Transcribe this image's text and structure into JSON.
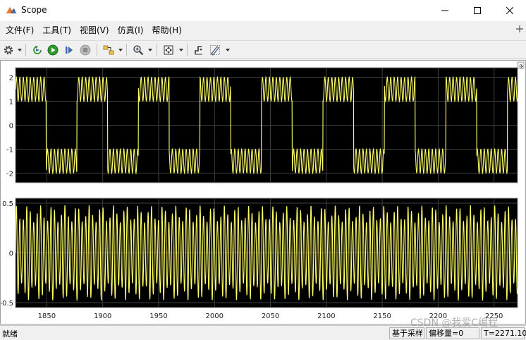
{
  "window": {
    "title": "Scope",
    "icon": "matlab-scope-icon",
    "controls": [
      "minimize-icon",
      "maximize-icon",
      "close-icon"
    ]
  },
  "menu": {
    "items": [
      {
        "label": "文件(F)"
      },
      {
        "label": "工具(T)"
      },
      {
        "label": "视图(V)"
      },
      {
        "label": "仿真(I)"
      },
      {
        "label": "帮助(H)"
      }
    ]
  },
  "toolbar": {
    "icons": [
      "gear-icon",
      "step-back-icon",
      "run-icon",
      "step-forward-icon",
      "stop-icon",
      "highlight-block-icon",
      "zoom-in-icon",
      "fit-to-view-icon",
      "triggers-icon",
      "cursor-measurement-icon"
    ]
  },
  "colors": {
    "plot_bg": "#000000",
    "axes_bg": "#ffffff",
    "grid": "#404040",
    "signal": "#ffff66",
    "axis_text": "#222222"
  },
  "chart_data": [
    {
      "type": "line",
      "yticks": [
        "2",
        "1",
        "0",
        "-1",
        "-2"
      ],
      "ylim": [
        -2.4,
        2.4
      ],
      "xlim": [
        1822,
        2271
      ],
      "grid": true,
      "series": [
        {
          "color": "#ffff66",
          "pattern": "square wave of amplitude 1.5 with superimposed high-frequency oscillation of amplitude 0.5"
        }
      ]
    },
    {
      "type": "line",
      "yticks": [
        "0.5",
        "0",
        "-0.5"
      ],
      "ylim": [
        -0.55,
        0.55
      ],
      "xlim": [
        1822,
        2271
      ],
      "xticks": [
        "1850",
        "1900",
        "1950",
        "2000",
        "2050",
        "2100",
        "2150",
        "2200",
        "2250"
      ],
      "grid": true,
      "series": [
        {
          "color": "#ffff66",
          "pattern": "high-frequency oscillation of amplitude 0.5"
        }
      ]
    }
  ],
  "status": {
    "text": "就绪",
    "sample_based": "基于采样",
    "offset": "偏移量=0",
    "time": "T=2271.100"
  },
  "watermark": "CSDN @我爱C编程"
}
